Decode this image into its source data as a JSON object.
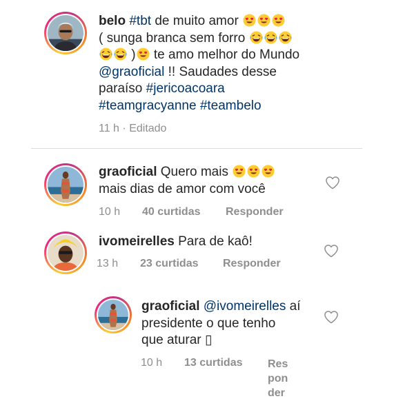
{
  "caption": {
    "username": "belo",
    "hashtag_tbt": "#tbt",
    "t1": "de muito amor",
    "t2": "( sunga branca sem forro",
    "t3": ")",
    "t4": "te amo melhor do Mundo",
    "mention": "@graoficial",
    "t5": "!! Saudades desse",
    "t6": "paraíso",
    "hashtag_jeri": "#jericoacoara",
    "hashtag_team1": "#teamgracyanne",
    "hashtag_team2": "#teambelo",
    "time": "11 h",
    "sep": "·",
    "edited": "Editado"
  },
  "comments": [
    {
      "username": "graoficial",
      "text_a": "Quero mais",
      "text_b": "mais dias de amor com você",
      "time": "10 h",
      "likes": "40 curtidas",
      "reply": "Responder"
    },
    {
      "username": "ivomeirelles",
      "text": "Para de kaô!",
      "time": "13 h",
      "likes": "23 curtidas",
      "reply": "Responder"
    }
  ],
  "reply": {
    "username": "graoficial",
    "mention": "@ivomeirelles",
    "text_a": "aí",
    "text_b": "presidente o que tenho",
    "text_c": "que aturar",
    "missing_glyph": "▯",
    "time": "10 h",
    "likes": "13 curtidas",
    "reply_1": "Res",
    "reply_2": "pon",
    "reply_3": "der"
  },
  "icons": {
    "heart_eyes": "heart-eyes-emoji-icon",
    "laughing": "laughing-emoji-icon",
    "like": "heart-outline-icon"
  },
  "colors": {
    "text": "#262626",
    "link": "#003569",
    "meta": "#8e8e8e",
    "divider": "#dbdbdb"
  }
}
